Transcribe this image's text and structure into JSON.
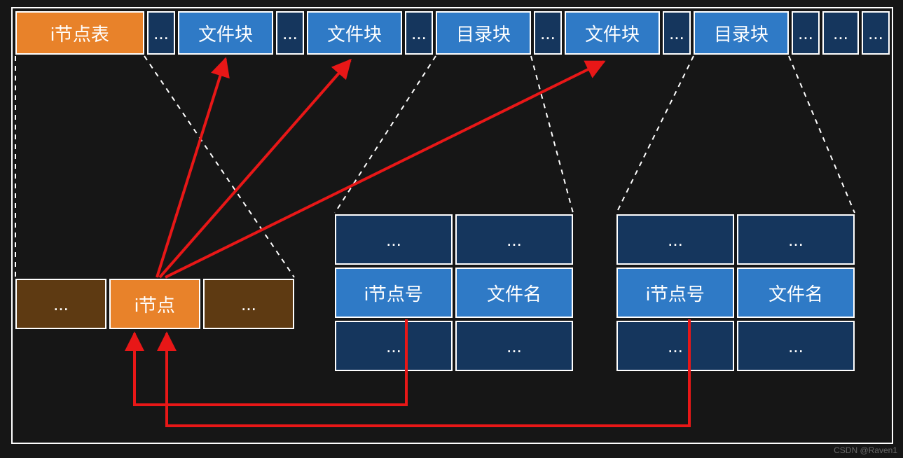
{
  "topRow": {
    "inodeTable": "i节点表",
    "ellipsis": "...",
    "fileBlock": "文件块",
    "dirBlock": "目录块"
  },
  "inodeRow": {
    "ellipsis": "...",
    "inode": "i节点"
  },
  "dirTable": {
    "ellipsis": "...",
    "inodeNum": "i节点号",
    "fileName": "文件名"
  },
  "credit": "CSDN @Raven1"
}
